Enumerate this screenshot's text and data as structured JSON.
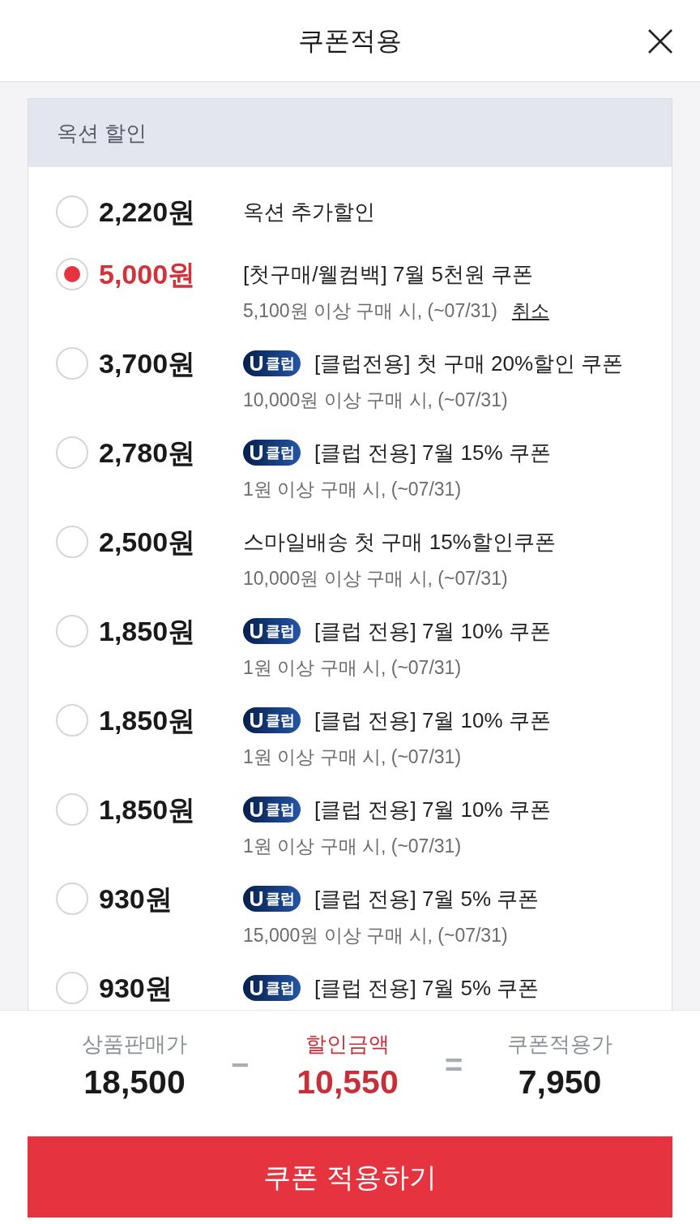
{
  "header": {
    "title": "쿠폰적용"
  },
  "section": {
    "title": "옥션 할인"
  },
  "coupons": [
    {
      "amount": "2,220원",
      "selected": false,
      "name": "옥션 추가할인"
    },
    {
      "amount": "5,000원",
      "selected": true,
      "name": "[첫구매/웰컴백] 7월 5천원 쿠폰",
      "condition": "5,100원 이상 구매 시, (~07/31)",
      "cancel": "취소"
    },
    {
      "amount": "3,700원",
      "selected": false,
      "badge": {
        "letter": "U",
        "label": "클럽"
      },
      "name": "[클럽전용] 첫 구매 20%할인 쿠폰",
      "condition": "10,000원 이상 구매 시, (~07/31)"
    },
    {
      "amount": "2,780원",
      "selected": false,
      "badge": {
        "letter": "U",
        "label": "클럽"
      },
      "name": "[클럽 전용] 7월 15% 쿠폰",
      "condition": "1원 이상 구매 시, (~07/31)"
    },
    {
      "amount": "2,500원",
      "selected": false,
      "name": "스마일배송 첫 구매 15%할인쿠폰",
      "condition": "10,000원 이상 구매 시, (~07/31)"
    },
    {
      "amount": "1,850원",
      "selected": false,
      "badge": {
        "letter": "U",
        "label": "클럽"
      },
      "name": "[클럽 전용] 7월 10% 쿠폰",
      "condition": "1원 이상 구매 시, (~07/31)"
    },
    {
      "amount": "1,850원",
      "selected": false,
      "badge": {
        "letter": "U",
        "label": "클럽"
      },
      "name": "[클럽 전용] 7월 10% 쿠폰",
      "condition": "1원 이상 구매 시, (~07/31)"
    },
    {
      "amount": "1,850원",
      "selected": false,
      "badge": {
        "letter": "U",
        "label": "클럽"
      },
      "name": "[클럽 전용] 7월 10% 쿠폰",
      "condition": "1원 이상 구매 시, (~07/31)"
    },
    {
      "amount": "930원",
      "selected": false,
      "badge": {
        "letter": "U",
        "label": "클럽"
      },
      "name": "[클럽 전용] 7월 5% 쿠폰",
      "condition": "15,000원 이상 구매 시, (~07/31)"
    },
    {
      "amount": "930원",
      "selected": false,
      "badge": {
        "letter": "U",
        "label": "클럽"
      },
      "name": "[클럽 전용] 7월 5% 쿠폰"
    }
  ],
  "summary": [
    {
      "kind": "value",
      "label": "상품판매가",
      "value": "18,500"
    },
    {
      "kind": "operator",
      "symbol": "−"
    },
    {
      "kind": "discount",
      "label": "할인금액",
      "value": "10,550"
    },
    {
      "kind": "operator",
      "symbol": "="
    },
    {
      "kind": "value",
      "label": "쿠폰적용가",
      "value": "7,950"
    }
  ],
  "apply_button": {
    "label": "쿠폰 적용하기"
  }
}
